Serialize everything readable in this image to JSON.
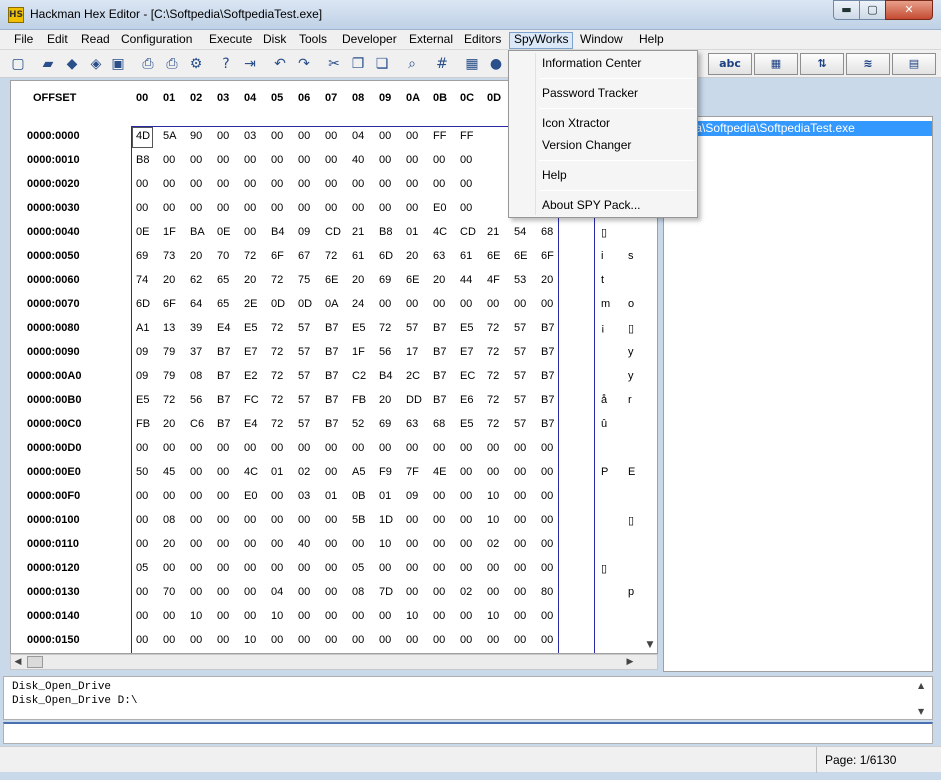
{
  "window": {
    "title": "Hackman Hex Editor - [C:\\Softpedia\\SoftpediaTest.exe]",
    "app_icon_text": "HS",
    "min_glyph": "▬",
    "max_glyph": "▢",
    "close_glyph": "✕"
  },
  "menu": [
    "File",
    "Edit",
    "Read",
    "Configuration",
    "Execute",
    "Disk",
    "Tools",
    "Developer",
    "External",
    "Editors",
    "SpyWorks",
    "Window",
    "Help"
  ],
  "spyworks_menu": [
    "Information Center",
    "Password Tracker",
    "Icon Xtractor",
    "Version Changer",
    "Help",
    "About SPY Pack..."
  ],
  "toolbar": {
    "icons": [
      "new-icon",
      "open-icon",
      "eraser-icon",
      "tag-icon",
      "save-icon",
      "print-icon",
      "print-setup-icon",
      "settings-icon",
      "help-icon",
      "exit-icon",
      "undo-icon",
      "redo-icon",
      "cut-icon",
      "copy-icon",
      "paste-icon",
      "find-icon",
      "grid-icon",
      "calculator-icon",
      "globe-icon"
    ],
    "glyphs": [
      "▢",
      "▰",
      "◆",
      "◈",
      "▣",
      "⎙",
      "⎙",
      "⚙",
      "?",
      "⇥",
      "↶",
      "↷",
      "✂",
      "❐",
      "❏",
      "⌕",
      "#",
      "▦",
      "●"
    ],
    "abc_label": "abc"
  },
  "hex": {
    "offset_header": "OFFSET",
    "columns": [
      "00",
      "01",
      "02",
      "03",
      "04",
      "05",
      "06",
      "07",
      "08",
      "09",
      "0A",
      "0B",
      "0C",
      "0D"
    ],
    "rows": [
      {
        "offset": "0000:0000",
        "bytes": [
          "4D",
          "5A",
          "90",
          "00",
          "03",
          "00",
          "00",
          "00",
          "04",
          "00",
          "00",
          "FF",
          "FF",
          ""
        ],
        "ascii": [
          "",
          ""
        ]
      },
      {
        "offset": "0000:0010",
        "bytes": [
          "B8",
          "00",
          "00",
          "00",
          "00",
          "00",
          "00",
          "00",
          "40",
          "00",
          "00",
          "00",
          "00",
          ""
        ],
        "ascii": [
          "",
          ""
        ]
      },
      {
        "offset": "0000:0020",
        "bytes": [
          "00",
          "00",
          "00",
          "00",
          "00",
          "00",
          "00",
          "00",
          "00",
          "00",
          "00",
          "00",
          "00",
          ""
        ],
        "ascii": [
          "",
          ""
        ]
      },
      {
        "offset": "0000:0030",
        "bytes": [
          "00",
          "00",
          "00",
          "00",
          "00",
          "00",
          "00",
          "00",
          "00",
          "00",
          "00",
          "E0",
          "00",
          ""
        ],
        "ascii": [
          "",
          ""
        ]
      },
      {
        "offset": "0000:0040",
        "bytes": [
          "0E",
          "1F",
          "BA",
          "0E",
          "00",
          "B4",
          "09",
          "CD",
          "21",
          "B8",
          "01",
          "4C",
          "CD",
          "21",
          "54",
          "68"
        ],
        "ascii": [
          "▯",
          ""
        ]
      },
      {
        "offset": "0000:0050",
        "bytes": [
          "69",
          "73",
          "20",
          "70",
          "72",
          "6F",
          "67",
          "72",
          "61",
          "6D",
          "20",
          "63",
          "61",
          "6E",
          "6E",
          "6F"
        ],
        "ascii": [
          "i",
          "s"
        ]
      },
      {
        "offset": "0000:0060",
        "bytes": [
          "74",
          "20",
          "62",
          "65",
          "20",
          "72",
          "75",
          "6E",
          "20",
          "69",
          "6E",
          "20",
          "44",
          "4F",
          "53",
          "20"
        ],
        "ascii": [
          "t",
          ""
        ]
      },
      {
        "offset": "0000:0070",
        "bytes": [
          "6D",
          "6F",
          "64",
          "65",
          "2E",
          "0D",
          "0D",
          "0A",
          "24",
          "00",
          "00",
          "00",
          "00",
          "00",
          "00",
          "00"
        ],
        "ascii": [
          "m",
          "o"
        ]
      },
      {
        "offset": "0000:0080",
        "bytes": [
          "A1",
          "13",
          "39",
          "E4",
          "E5",
          "72",
          "57",
          "B7",
          "E5",
          "72",
          "57",
          "B7",
          "E5",
          "72",
          "57",
          "B7"
        ],
        "ascii": [
          "¡",
          "▯"
        ]
      },
      {
        "offset": "0000:0090",
        "bytes": [
          "09",
          "79",
          "37",
          "B7",
          "E7",
          "72",
          "57",
          "B7",
          "1F",
          "56",
          "17",
          "B7",
          "E7",
          "72",
          "57",
          "B7"
        ],
        "ascii": [
          "",
          "y"
        ]
      },
      {
        "offset": "0000:00A0",
        "bytes": [
          "09",
          "79",
          "08",
          "B7",
          "E2",
          "72",
          "57",
          "B7",
          "C2",
          "B4",
          "2C",
          "B7",
          "EC",
          "72",
          "57",
          "B7"
        ],
        "ascii": [
          "",
          "y"
        ]
      },
      {
        "offset": "0000:00B0",
        "bytes": [
          "E5",
          "72",
          "56",
          "B7",
          "FC",
          "72",
          "57",
          "B7",
          "FB",
          "20",
          "DD",
          "B7",
          "E6",
          "72",
          "57",
          "B7"
        ],
        "ascii": [
          "å",
          "r"
        ]
      },
      {
        "offset": "0000:00C0",
        "bytes": [
          "FB",
          "20",
          "C6",
          "B7",
          "E4",
          "72",
          "57",
          "B7",
          "52",
          "69",
          "63",
          "68",
          "E5",
          "72",
          "57",
          "B7"
        ],
        "ascii": [
          "û",
          ""
        ]
      },
      {
        "offset": "0000:00D0",
        "bytes": [
          "00",
          "00",
          "00",
          "00",
          "00",
          "00",
          "00",
          "00",
          "00",
          "00",
          "00",
          "00",
          "00",
          "00",
          "00",
          "00"
        ],
        "ascii": [
          "",
          ""
        ]
      },
      {
        "offset": "0000:00E0",
        "bytes": [
          "50",
          "45",
          "00",
          "00",
          "4C",
          "01",
          "02",
          "00",
          "A5",
          "F9",
          "7F",
          "4E",
          "00",
          "00",
          "00",
          "00"
        ],
        "ascii": [
          "P",
          "E"
        ]
      },
      {
        "offset": "0000:00F0",
        "bytes": [
          "00",
          "00",
          "00",
          "00",
          "E0",
          "00",
          "03",
          "01",
          "0B",
          "01",
          "09",
          "00",
          "00",
          "10",
          "00",
          "00"
        ],
        "ascii": [
          "",
          ""
        ]
      },
      {
        "offset": "0000:0100",
        "bytes": [
          "00",
          "08",
          "00",
          "00",
          "00",
          "00",
          "00",
          "00",
          "5B",
          "1D",
          "00",
          "00",
          "00",
          "10",
          "00",
          "00"
        ],
        "ascii": [
          "",
          "▯"
        ]
      },
      {
        "offset": "0000:0110",
        "bytes": [
          "00",
          "20",
          "00",
          "00",
          "00",
          "00",
          "40",
          "00",
          "00",
          "10",
          "00",
          "00",
          "00",
          "02",
          "00",
          "00"
        ],
        "ascii": [
          "",
          ""
        ]
      },
      {
        "offset": "0000:0120",
        "bytes": [
          "05",
          "00",
          "00",
          "00",
          "00",
          "00",
          "00",
          "00",
          "05",
          "00",
          "00",
          "00",
          "00",
          "00",
          "00",
          "00"
        ],
        "ascii": [
          "▯",
          ""
        ]
      },
      {
        "offset": "0000:0130",
        "bytes": [
          "00",
          "70",
          "00",
          "00",
          "00",
          "04",
          "00",
          "00",
          "08",
          "7D",
          "00",
          "00",
          "02",
          "00",
          "00",
          "80"
        ],
        "ascii": [
          "",
          "p"
        ]
      },
      {
        "offset": "0000:0140",
        "bytes": [
          "00",
          "00",
          "10",
          "00",
          "00",
          "10",
          "00",
          "00",
          "00",
          "00",
          "10",
          "00",
          "00",
          "10",
          "00",
          "00"
        ],
        "ascii": [
          "",
          ""
        ]
      },
      {
        "offset": "0000:0150",
        "bytes": [
          "00",
          "00",
          "00",
          "00",
          "10",
          "00",
          "00",
          "00",
          "00",
          "00",
          "00",
          "00",
          "00",
          "00",
          "00",
          "00"
        ],
        "ascii": [
          "",
          ""
        ]
      }
    ]
  },
  "file_tree": {
    "item": "ftpedia\\Softpedia\\SoftpediaTest.exe"
  },
  "log": {
    "lines": [
      "Disk_Open_Drive",
      "Disk_Open_Drive D:\\"
    ]
  },
  "status": {
    "page": "Page: 1/6130"
  },
  "colors": {
    "accent_selection": "#3399ff",
    "hex_border": "#2828a8",
    "menu_open_bg": "#dbe8f7"
  }
}
